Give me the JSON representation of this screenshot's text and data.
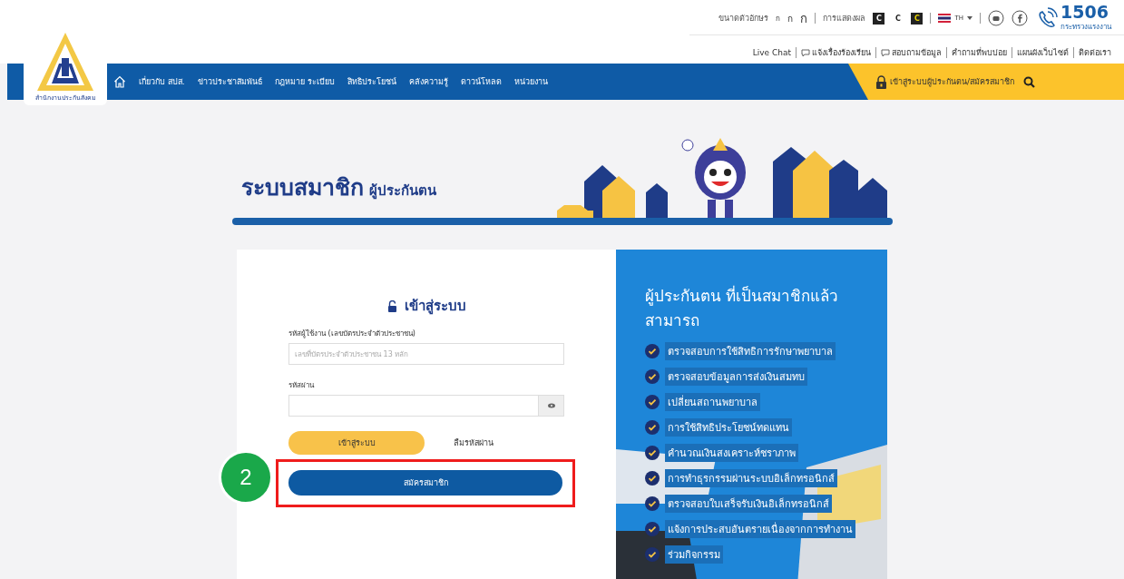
{
  "header": {
    "font_size_label": "ขนาดตัวอักษร",
    "font_sizes": [
      {
        "label": "ก",
        "kind": "small"
      },
      {
        "label": "ก",
        "kind": "medium"
      },
      {
        "label": "ก",
        "kind": "large"
      }
    ],
    "contrast_label": "การแสดงผล",
    "contrast_options": [
      {
        "label": "C",
        "kind": "dark"
      },
      {
        "label": "C",
        "kind": "light"
      },
      {
        "label": "C",
        "kind": "yellow"
      }
    ],
    "language": "TH",
    "hotline": "1506",
    "hotline_caption": "กระทรวงแรงงาน",
    "links": [
      "Live Chat",
      "แจ้งเรื่องร้องเรียน",
      "สอบถามข้อมูล",
      "คำถามที่พบบ่อย",
      "แผนผังเว็บไซต์",
      "ติดต่อเรา"
    ]
  },
  "logo": {
    "caption": "สำนักงานประกันสังคม"
  },
  "nav": {
    "items": [
      "เกี่ยวกับ สปส.",
      "ข่าวประชาสัมพันธ์",
      "กฎหมาย ระเบียบ",
      "สิทธิประโยชน์",
      "คลังความรู้",
      "ดาวน์โหลด",
      "หน่วยงาน"
    ],
    "login_link": "เข้าสู่ระบบผู้ประกันตน/สมัครสมาชิก"
  },
  "banner": {
    "title": "ระบบสมาชิก",
    "subtitle": "ผู้ประกันตน"
  },
  "login": {
    "title": "เข้าสู่ระบบ",
    "username_label": "รหัสผู้ใช้งาน (เลขบัตรประจำตัวประชาชน)",
    "username_placeholder": "เลขที่บัตรประจำตัวประชาชน 13 หลัก",
    "password_label": "รหัสผ่าน",
    "login_button": "เข้าสู่ระบบ",
    "forgot_link": "ลืมรหัสผ่าน",
    "register_button": "สมัครสมาชิก",
    "step_badge": "2"
  },
  "benefits": {
    "title": "ผู้ประกันตน ที่เป็นสมาชิกแล้ว สามารถ",
    "items": [
      "ตรวจสอบการใช้สิทธิการรักษาพยาบาล",
      "ตรวจสอบข้อมูลการส่งเงินสมทบ",
      "เปลี่ยนสถานพยาบาล",
      "การใช้สิทธิประโยชน์ทดแทน",
      "คำนวณเงินสงเคราะห์ชราภาพ",
      "การทำธุรกรรมผ่านระบบอิเล็กทรอนิกส์",
      "ตรวจสอบใบเสร็จรับเงินอิเล็กทรอนิกส์",
      "แจ้งการประสบอันตรายเนื่องจากการทำงาน",
      "ร่วมกิจกรรม"
    ]
  }
}
